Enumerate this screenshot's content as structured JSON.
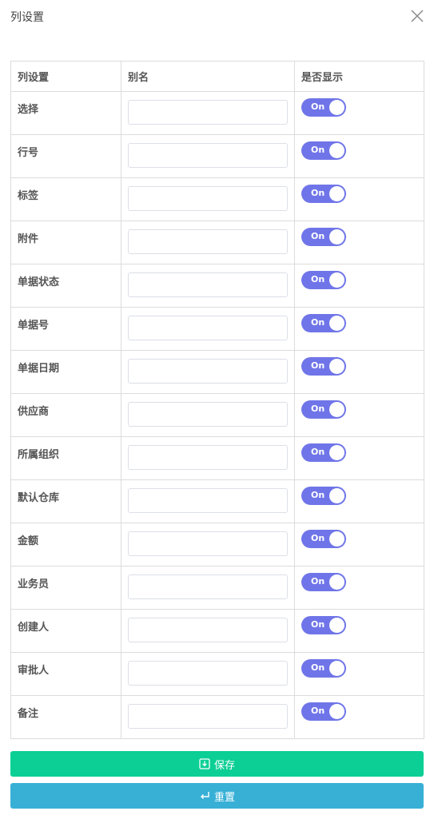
{
  "dialog": {
    "title": "列设置",
    "close_icon": "close-icon"
  },
  "table": {
    "headers": {
      "column": "列设置",
      "alias": "别名",
      "visible": "是否显示"
    },
    "rows": [
      {
        "name": "选择",
        "alias": "",
        "toggle": "On"
      },
      {
        "name": "行号",
        "alias": "",
        "toggle": "On"
      },
      {
        "name": "标签",
        "alias": "",
        "toggle": "On"
      },
      {
        "name": "附件",
        "alias": "",
        "toggle": "On"
      },
      {
        "name": "单据状态",
        "alias": "",
        "toggle": "On"
      },
      {
        "name": "单据号",
        "alias": "",
        "toggle": "On"
      },
      {
        "name": "单据日期",
        "alias": "",
        "toggle": "On"
      },
      {
        "name": "供应商",
        "alias": "",
        "toggle": "On"
      },
      {
        "name": "所属组织",
        "alias": "",
        "toggle": "On"
      },
      {
        "name": "默认仓库",
        "alias": "",
        "toggle": "On"
      },
      {
        "name": "金额",
        "alias": "",
        "toggle": "On"
      },
      {
        "name": "业务员",
        "alias": "",
        "toggle": "On"
      },
      {
        "name": "创建人",
        "alias": "",
        "toggle": "On"
      },
      {
        "name": "审批人",
        "alias": "",
        "toggle": "On"
      },
      {
        "name": "备注",
        "alias": "",
        "toggle": "On"
      }
    ]
  },
  "buttons": {
    "save": {
      "label": "保存",
      "icon": "save-icon",
      "color": "#0ccf95"
    },
    "reset": {
      "label": "重置",
      "icon": "return-icon",
      "color": "#38b0d6"
    }
  },
  "colors": {
    "toggle_on": "#6f75e8",
    "border": "#dcdcdc"
  }
}
